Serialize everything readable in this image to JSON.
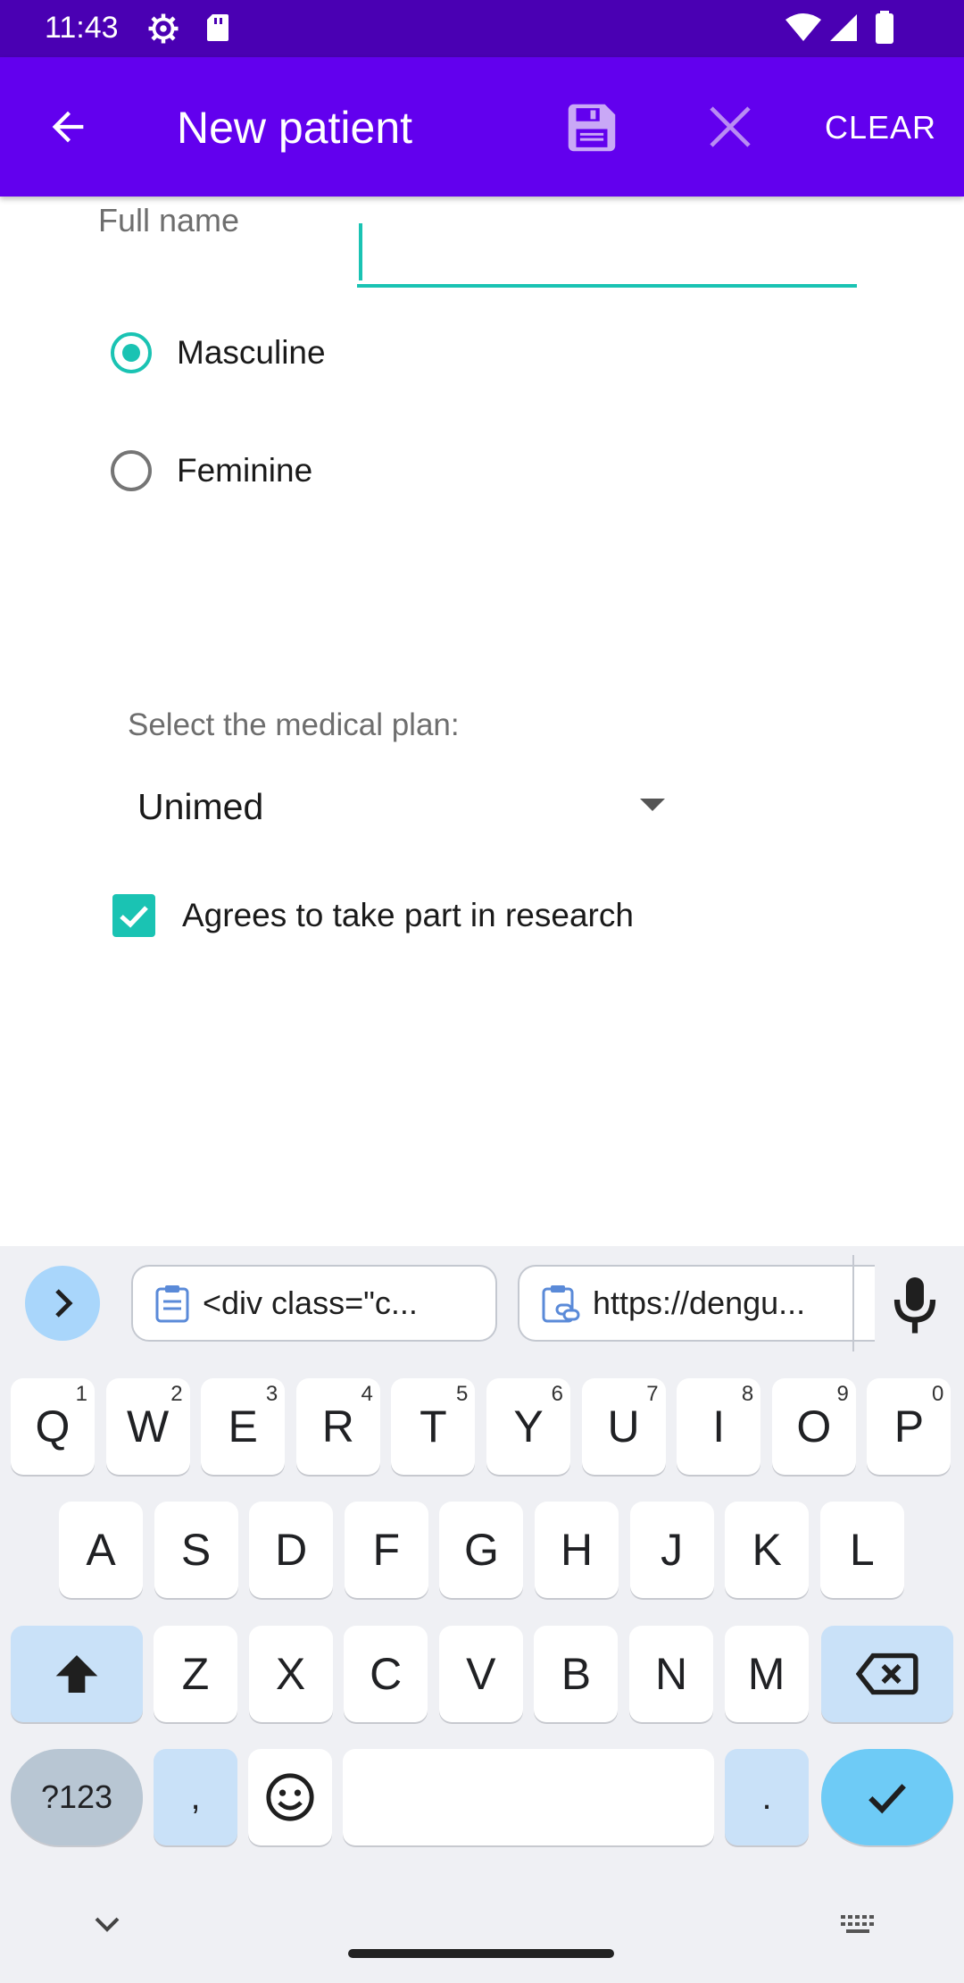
{
  "status_bar": {
    "time": "11:43"
  },
  "app_bar": {
    "title": "New patient",
    "clear_label": "CLEAR",
    "icons": [
      "back-arrow-icon",
      "save-icon",
      "close-icon"
    ]
  },
  "form": {
    "full_name_label": "Full name",
    "full_name_value": "",
    "gender_options": [
      {
        "label": "Masculine",
        "selected": true
      },
      {
        "label": "Feminine",
        "selected": false
      }
    ],
    "plan_label": "Select the medical plan:",
    "plan_selected": "Unimed",
    "research_label": "Agrees to take part in research",
    "research_checked": true
  },
  "keyboard": {
    "clipboard": [
      {
        "text": "<div class=\"c...",
        "icon": "clipboard-icon"
      },
      {
        "text": "https://dengu...",
        "icon": "clipboard-link-icon"
      }
    ],
    "row1": [
      {
        "label": "Q",
        "hint": "1"
      },
      {
        "label": "W",
        "hint": "2"
      },
      {
        "label": "E",
        "hint": "3"
      },
      {
        "label": "R",
        "hint": "4"
      },
      {
        "label": "T",
        "hint": "5"
      },
      {
        "label": "Y",
        "hint": "6"
      },
      {
        "label": "U",
        "hint": "7"
      },
      {
        "label": "I",
        "hint": "8"
      },
      {
        "label": "O",
        "hint": "9"
      },
      {
        "label": "P",
        "hint": "0"
      }
    ],
    "row2": [
      "A",
      "S",
      "D",
      "F",
      "G",
      "H",
      "J",
      "K",
      "L"
    ],
    "row3": [
      "Z",
      "X",
      "C",
      "V",
      "B",
      "N",
      "M"
    ],
    "symbols_label": "?123",
    "comma_label": ",",
    "period_label": ".",
    "colors": {
      "accent": "#1ac3b3",
      "app_bar": "#6200ee",
      "status_bar": "#4a00b3",
      "key_mod": "#c9e1f8",
      "enter": "#6ecbf6"
    }
  }
}
